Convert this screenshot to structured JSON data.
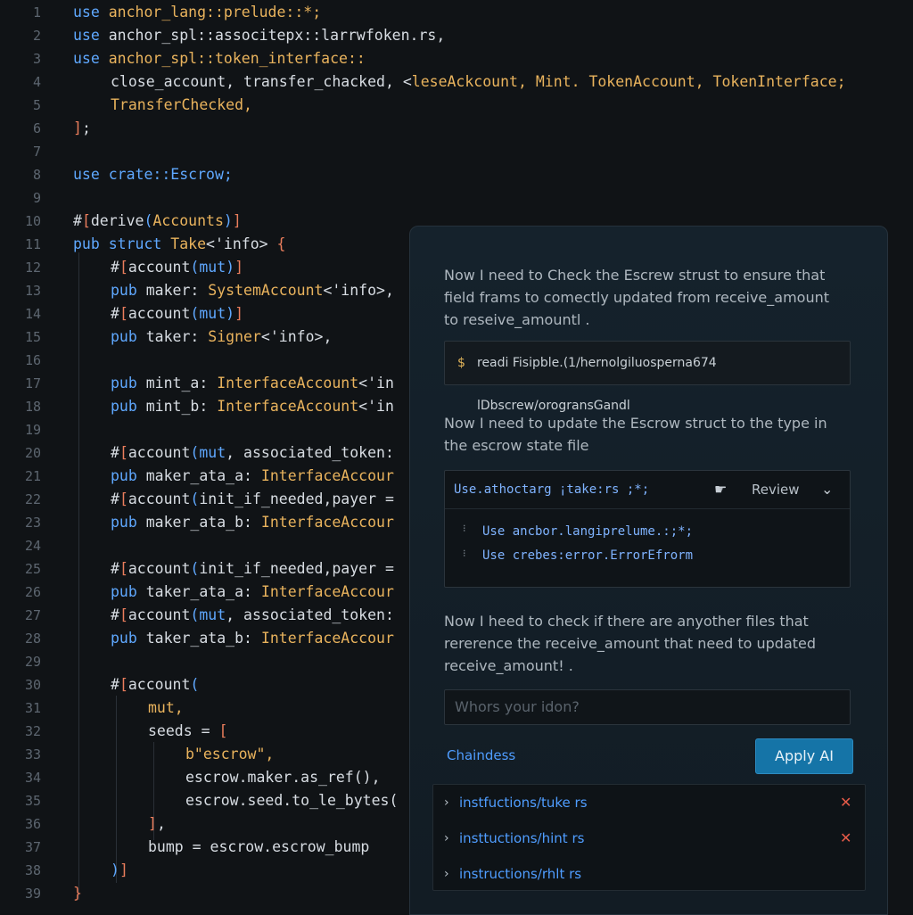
{
  "editor": {
    "lines": [
      {
        "n": "1",
        "indent": 0,
        "tokens": [
          {
            "c": "kw",
            "t": "use"
          },
          {
            "c": "ty",
            "t": " anchor_lang::prelude::*;"
          }
        ]
      },
      {
        "n": "2",
        "indent": 0,
        "tokens": [
          {
            "c": "kw",
            "t": "use"
          },
          {
            "c": "tx",
            "t": " anchor_spl::associ"
          },
          {
            "c": "tx",
            "t": "tep"
          },
          {
            "c": "tx",
            "t": "x::larrwfoken.rs,"
          }
        ]
      },
      {
        "n": "3",
        "indent": 0,
        "tokens": [
          {
            "c": "kw",
            "t": "use"
          },
          {
            "c": "ty",
            "t": " anchor_spl::token_interface::"
          }
        ]
      },
      {
        "n": "4",
        "indent": 1,
        "tokens": [
          {
            "c": "tx",
            "t": "close_account, transfer_chacked, <"
          },
          {
            "c": "ty",
            "t": "leseAckcount, Mint. TokenAccount, TokenInterface;"
          }
        ]
      },
      {
        "n": "5",
        "indent": 1,
        "tokens": [
          {
            "c": "ty",
            "t": "TransferChecked,"
          }
        ]
      },
      {
        "n": "6",
        "indent": 0,
        "tokens": [
          {
            "c": "at",
            "t": "]"
          },
          {
            "c": "tx",
            "t": ";"
          }
        ]
      },
      {
        "n": "7",
        "indent": 0,
        "tokens": []
      },
      {
        "n": "8",
        "indent": 0,
        "tokens": [
          {
            "c": "kw",
            "t": "use"
          },
          {
            "c": "kw",
            "t": " crate::Escrow;"
          }
        ]
      },
      {
        "n": "9",
        "indent": 0,
        "tokens": []
      },
      {
        "n": "10",
        "indent": 0,
        "tokens": [
          {
            "c": "tx",
            "t": "#"
          },
          {
            "c": "at",
            "t": "["
          },
          {
            "c": "tx",
            "t": "derive"
          },
          {
            "c": "kw",
            "t": "("
          },
          {
            "c": "ty",
            "t": "Accounts"
          },
          {
            "c": "kw",
            "t": ")"
          },
          {
            "c": "at",
            "t": "]"
          }
        ]
      },
      {
        "n": "11",
        "indent": 0,
        "tokens": [
          {
            "c": "kw",
            "t": "pub"
          },
          {
            "c": "kw",
            "t": " struct"
          },
          {
            "c": "ty",
            "t": " Take"
          },
          {
            "c": "tx",
            "t": "<'info> "
          },
          {
            "c": "at",
            "t": "{"
          }
        ]
      },
      {
        "n": "12",
        "indent": 1,
        "tokens": [
          {
            "c": "tx",
            "t": "#"
          },
          {
            "c": "at",
            "t": "["
          },
          {
            "c": "tx",
            "t": "account"
          },
          {
            "c": "kw",
            "t": "(mut)"
          },
          {
            "c": "at",
            "t": "]"
          }
        ]
      },
      {
        "n": "13",
        "indent": 1,
        "tokens": [
          {
            "c": "kw",
            "t": "pub"
          },
          {
            "c": "tx",
            "t": " maker: "
          },
          {
            "c": "ty",
            "t": "SystemAccount"
          },
          {
            "c": "tx",
            "t": "<'info>,"
          }
        ]
      },
      {
        "n": "14",
        "indent": 1,
        "tokens": [
          {
            "c": "tx",
            "t": "#"
          },
          {
            "c": "at",
            "t": "["
          },
          {
            "c": "tx",
            "t": "account"
          },
          {
            "c": "kw",
            "t": "(mut)"
          },
          {
            "c": "at",
            "t": "]"
          }
        ]
      },
      {
        "n": "15",
        "indent": 1,
        "tokens": [
          {
            "c": "kw",
            "t": "pub"
          },
          {
            "c": "tx",
            "t": " taker: "
          },
          {
            "c": "ty",
            "t": "Signer"
          },
          {
            "c": "tx",
            "t": "<'info>,"
          }
        ]
      },
      {
        "n": "16",
        "indent": 0,
        "tokens": []
      },
      {
        "n": "17",
        "indent": 1,
        "tokens": [
          {
            "c": "kw",
            "t": "pub"
          },
          {
            "c": "tx",
            "t": " mint_a: "
          },
          {
            "c": "ty",
            "t": "InterfaceAccount"
          },
          {
            "c": "tx",
            "t": "<'in"
          }
        ]
      },
      {
        "n": "18",
        "indent": 1,
        "tokens": [
          {
            "c": "kw",
            "t": "pub"
          },
          {
            "c": "tx",
            "t": " mint_b: "
          },
          {
            "c": "ty",
            "t": "InterfaceAccount"
          },
          {
            "c": "tx",
            "t": "<'in"
          }
        ]
      },
      {
        "n": "19",
        "indent": 0,
        "tokens": []
      },
      {
        "n": "20",
        "indent": 1,
        "tokens": [
          {
            "c": "tx",
            "t": "#"
          },
          {
            "c": "at",
            "t": "["
          },
          {
            "c": "tx",
            "t": "account"
          },
          {
            "c": "kw",
            "t": "(mut"
          },
          {
            "c": "tx",
            "t": ", associated_token:"
          }
        ]
      },
      {
        "n": "21",
        "indent": 1,
        "tokens": [
          {
            "c": "kw",
            "t": "pub"
          },
          {
            "c": "tx",
            "t": " maker_ata_a: "
          },
          {
            "c": "ty",
            "t": "InterfaceAccour"
          }
        ]
      },
      {
        "n": "22",
        "indent": 1,
        "tokens": [
          {
            "c": "tx",
            "t": "#"
          },
          {
            "c": "at",
            "t": "["
          },
          {
            "c": "tx",
            "t": "account"
          },
          {
            "c": "kw",
            "t": "("
          },
          {
            "c": "tx",
            "t": "init_if_needed,payer ="
          }
        ]
      },
      {
        "n": "23",
        "indent": 1,
        "tokens": [
          {
            "c": "kw",
            "t": "pub"
          },
          {
            "c": "tx",
            "t": " maker_ata_b: "
          },
          {
            "c": "ty",
            "t": "InterfaceAccour"
          }
        ]
      },
      {
        "n": "24",
        "indent": 0,
        "tokens": []
      },
      {
        "n": "25",
        "indent": 1,
        "tokens": [
          {
            "c": "tx",
            "t": "#"
          },
          {
            "c": "at",
            "t": "["
          },
          {
            "c": "tx",
            "t": "account"
          },
          {
            "c": "kw",
            "t": "("
          },
          {
            "c": "tx",
            "t": "init_if_needed,payer ="
          }
        ]
      },
      {
        "n": "26",
        "indent": 1,
        "tokens": [
          {
            "c": "kw",
            "t": "pub"
          },
          {
            "c": "tx",
            "t": " taker_ata_a: "
          },
          {
            "c": "ty",
            "t": "InterfaceAccour"
          }
        ]
      },
      {
        "n": "27",
        "indent": 1,
        "tokens": [
          {
            "c": "tx",
            "t": "#"
          },
          {
            "c": "at",
            "t": "["
          },
          {
            "c": "tx",
            "t": "account"
          },
          {
            "c": "kw",
            "t": "(mut"
          },
          {
            "c": "tx",
            "t": ", associated_token:"
          }
        ]
      },
      {
        "n": "28",
        "indent": 1,
        "tokens": [
          {
            "c": "kw",
            "t": "pub"
          },
          {
            "c": "tx",
            "t": " taker_ata_b: "
          },
          {
            "c": "ty",
            "t": "InterfaceAccour"
          }
        ]
      },
      {
        "n": "29",
        "indent": 0,
        "tokens": []
      },
      {
        "n": "30",
        "indent": 1,
        "tokens": [
          {
            "c": "tx",
            "t": "#"
          },
          {
            "c": "at",
            "t": "["
          },
          {
            "c": "tx",
            "t": "account"
          },
          {
            "c": "kw",
            "t": "("
          }
        ]
      },
      {
        "n": "31",
        "indent": 2,
        "tokens": [
          {
            "c": "ty",
            "t": "mut,"
          }
        ]
      },
      {
        "n": "32",
        "indent": 2,
        "tokens": [
          {
            "c": "tx",
            "t": "seeds = "
          },
          {
            "c": "at",
            "t": "["
          }
        ]
      },
      {
        "n": "33",
        "indent": 3,
        "tokens": [
          {
            "c": "ty",
            "t": "b\"escrow\","
          }
        ]
      },
      {
        "n": "34",
        "indent": 3,
        "tokens": [
          {
            "c": "tx",
            "t": "escrow.maker.as_ref(),"
          }
        ]
      },
      {
        "n": "35",
        "indent": 3,
        "tokens": [
          {
            "c": "tx",
            "t": "escrow.seed.to_le_bytes("
          }
        ]
      },
      {
        "n": "36",
        "indent": 2,
        "tokens": [
          {
            "c": "at",
            "t": "]"
          },
          {
            "c": "tx",
            "t": ","
          }
        ]
      },
      {
        "n": "37",
        "indent": 2,
        "tokens": [
          {
            "c": "tx",
            "t": "bump = escrow.escrow_bump"
          }
        ]
      },
      {
        "n": "38",
        "indent": 1,
        "tokens": [
          {
            "c": "kw",
            "t": ")"
          },
          {
            "c": "at",
            "t": "]"
          }
        ]
      },
      {
        "n": "39",
        "indent": 0,
        "tokens": [
          {
            "c": "at",
            "t": "}"
          }
        ]
      }
    ]
  },
  "assistant": {
    "msg1": "Now I need to  Check the Escrew strust to ensure that field frams to comectly updated from receive_amount to reseive_amountl .",
    "path_icon": "terminal-icon",
    "path_text": "readi Fisipble.(1/hernolgiluosperna674 lDbscrew/orogransGandl",
    "msg2": "Now I need to update the Escrow struct to the type in the escrow state file",
    "code_file": "Use.athoctarg ¡take:rs ;*;",
    "review_label": "Review",
    "code_lines": [
      "Use ancbor.langiprelume.:;*;",
      "Use crebes:error.ErrorEfrorm"
    ],
    "msg3": "Now I heed to check if there are anyother files that rererence the receive_amount that need to updated receive_amount!  .",
    "input_placeholder": "Whors your idon?",
    "changes_label": "Chaindess",
    "apply_label": "Apply AI",
    "files": [
      {
        "name": "instfuctions/tuke rs",
        "removable": true
      },
      {
        "name": "insttuctions/hint rs",
        "removable": true
      },
      {
        "name": "instructions/rhlt rs",
        "removable": false
      }
    ]
  },
  "colors": {
    "keyword": "#5fa8ff",
    "type": "#e9b35d",
    "attr": "#ea7d5c",
    "link": "#4f9dff",
    "apply_bg": "#1574a7",
    "remove": "#e55a48"
  }
}
